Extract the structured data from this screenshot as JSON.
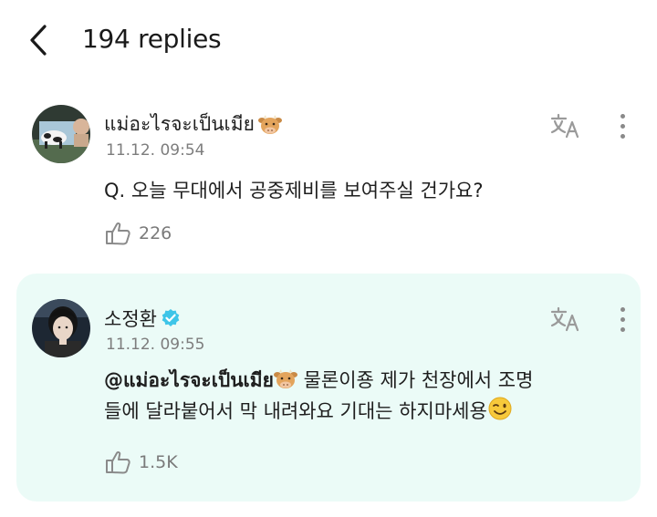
{
  "header": {
    "title": "194 replies",
    "back_icon": "chevron-left-icon"
  },
  "replies": [
    {
      "author": "แม่อะไรจะเป็นเมีย",
      "author_emoji": "cow-face",
      "date": "11.12. 09:54",
      "text": "Q. 오늘 무대에서 공중제비를 보여주실 건가요?",
      "likes": "226",
      "verified": false
    },
    {
      "author": "소정환",
      "date": "11.12. 09:55",
      "mention": "@แม่อะไรจะเป็นเมีย",
      "mention_emoji": "cow-face",
      "text_line1": "물론이죵 제가 천장에서 조명",
      "text_line2": "들에 달라붙어서 막 내려와요 기대는 하지마세용",
      "trailing_emoji": "winking-face",
      "likes": "1.5K",
      "verified": true,
      "highlight_color": "#ebfbf7"
    }
  ]
}
